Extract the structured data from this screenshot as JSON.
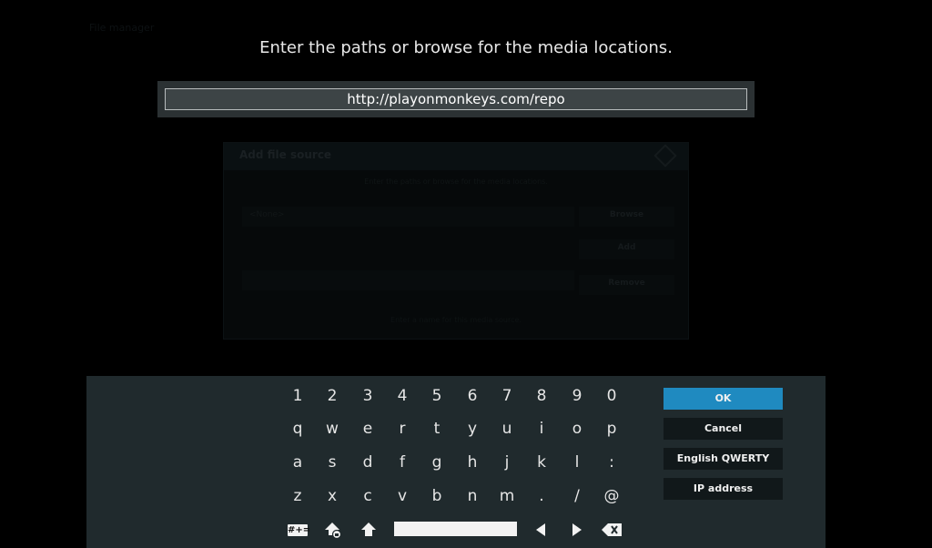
{
  "heading": "Enter the paths or browse for the media locations.",
  "input": {
    "value": "http://playonmonkeys.com/repo"
  },
  "background_dialog": {
    "title": "Add file source",
    "subtitle": "Enter the paths or browse for the media locations.",
    "row1_label": "<None>",
    "browse_label": "Browse",
    "add_label": "Add",
    "remove_label": "Remove",
    "footer": "Enter a name for this media source."
  },
  "keyboard": {
    "row1": [
      "1",
      "2",
      "3",
      "4",
      "5",
      "6",
      "7",
      "8",
      "9",
      "0"
    ],
    "row2": [
      "q",
      "w",
      "e",
      "r",
      "t",
      "y",
      "u",
      "i",
      "o",
      "p"
    ],
    "row3": [
      "a",
      "s",
      "d",
      "f",
      "g",
      "h",
      "j",
      "k",
      "l",
      ":"
    ],
    "row4": [
      "z",
      "x",
      "c",
      "v",
      "b",
      "n",
      "m",
      ".",
      "/",
      "@"
    ],
    "symbols_label": "#+=",
    "buttons": {
      "ok": "OK",
      "cancel": "Cancel",
      "layout": "English QWERTY",
      "ip": "IP address"
    }
  },
  "colors": {
    "accent": "#1f8ac0",
    "panel": "#202a2d"
  }
}
